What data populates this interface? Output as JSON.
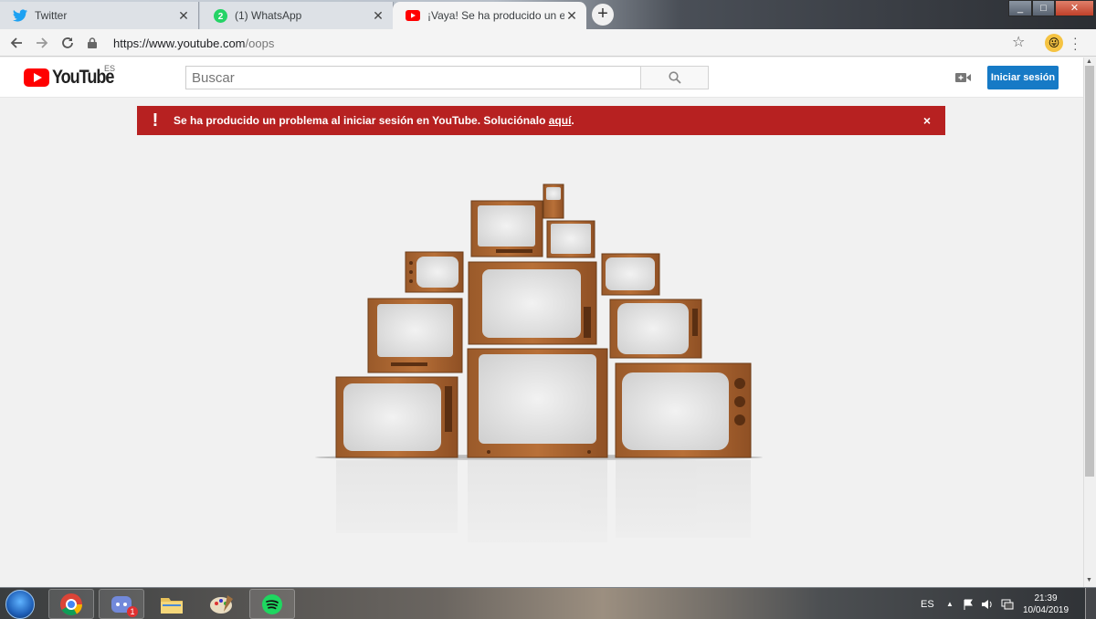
{
  "browser": {
    "tabs": [
      {
        "title": "Twitter",
        "favicon": "twitter-bird-icon"
      },
      {
        "title": "(1) WhatsApp",
        "favicon": "whatsapp-icon",
        "badge": "2"
      },
      {
        "title": "¡Vaya! Se ha producido un error",
        "favicon": "youtube-icon"
      }
    ],
    "url_host": "https://www.youtube.com",
    "url_path": "/oops",
    "window_controls": {
      "minimize": "_",
      "maximize": "□",
      "close": "✕"
    }
  },
  "youtube": {
    "logo_word": "YouTube",
    "country_code": "ES",
    "search_placeholder": "Buscar",
    "signin_label": "Iniciar sesión",
    "brand_red": "#ff0000",
    "signin_blue": "#167ac6"
  },
  "alert": {
    "icon": "!",
    "message": "Se ha producido un problema al iniciar sesión en YouTube. Soluciónalo ",
    "link_text": "aquí",
    "suffix": ".",
    "close": "×",
    "color": "#b72121"
  },
  "taskbar": {
    "apps": [
      "chrome-icon",
      "discord-icon",
      "file-explorer-icon",
      "paint-icon",
      "spotify-icon"
    ],
    "discord_badge": "1",
    "language": "ES",
    "time": "21:39",
    "date": "10/04/2019"
  }
}
